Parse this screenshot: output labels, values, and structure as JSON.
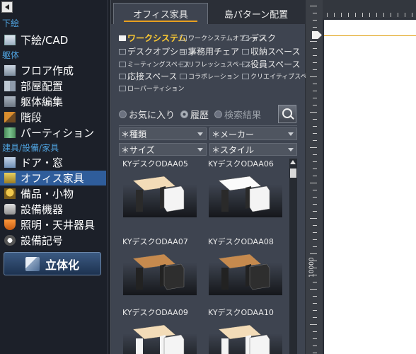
{
  "sidebar": {
    "sections": {
      "sketch": "下絵",
      "frame": "躯体",
      "fixtures": "建具/設備/家具"
    },
    "items": {
      "cad": "下絵/CAD",
      "floor": "フロア作成",
      "room": "部屋配置",
      "frame_edit": "躯体編集",
      "stairs": "階段",
      "partition": "パーティション",
      "door": "ドア・窓",
      "office": "オフィス家具",
      "goods": "備品・小物",
      "equipment": "設備機器",
      "lighting": "照明・天井器具",
      "symbol": "設備記号"
    },
    "active_item": "オフィス家具",
    "render_button": "立体化"
  },
  "panel": {
    "tabs": {
      "office_furniture": "オフィス家具",
      "island_pattern": "島パターン配置"
    },
    "active_tab": "オフィス家具",
    "categories": {
      "work_system": "ワークシステム",
      "work_system_option": "ワークシステムオプション",
      "desk": "デスク",
      "desk_option": "デスクオプション",
      "office_chair": "事務用チェア",
      "storage": "収納スペース",
      "meeting": "ミーティングスペース",
      "refresh": "リフレッシュスペース",
      "executive": "役員スペース",
      "reception": "応接スペース",
      "collaboration": "コラボレーション",
      "creative": "クリエイティブスペース",
      "low_partition": "ローパーティション"
    },
    "selected_category": "ワークシステム",
    "filters": {
      "favorites": "お気に入り",
      "history": "履歴",
      "search_results": "検索結果"
    },
    "dropdowns": {
      "type": "＊種類",
      "maker": "＊メーカー",
      "size": "＊サイズ",
      "style": "＊スタイル"
    },
    "products": [
      {
        "name": "KYデスクODAA05",
        "top_color": "#f3dcb8",
        "body_color": "#2a2a2a",
        "side_color": "#f4f4f4"
      },
      {
        "name": "KYデスクODAA06",
        "top_color": "#fbfbfb",
        "body_color": "#2a2a2a",
        "side_color": "#f4f4f4"
      },
      {
        "name": "KYデスクODAA07",
        "top_color": "#c68a4e",
        "body_color": "#222222",
        "side_color": "#2e2e2e"
      },
      {
        "name": "KYデスクODAA08",
        "top_color": "#c68a4e",
        "body_color": "#222222",
        "side_color": "#2e2e2e"
      },
      {
        "name": "KYデスクODAA09",
        "top_color": "#f3dcb8",
        "body_color": "#f4f4f4",
        "side_color": "#f4f4f4"
      },
      {
        "name": "KYデスクODAA10",
        "top_color": "#f3dcb8",
        "body_color": "#f4f4f4",
        "side_color": "#f4f4f4"
      }
    ]
  },
  "canvas": {
    "ruler_label": "10000",
    "guide_color": "#e2a51e"
  },
  "colors": {
    "accent": "#2f5d9b",
    "section_text": "#4fa3e0",
    "selected_category": "#ffcc33"
  }
}
